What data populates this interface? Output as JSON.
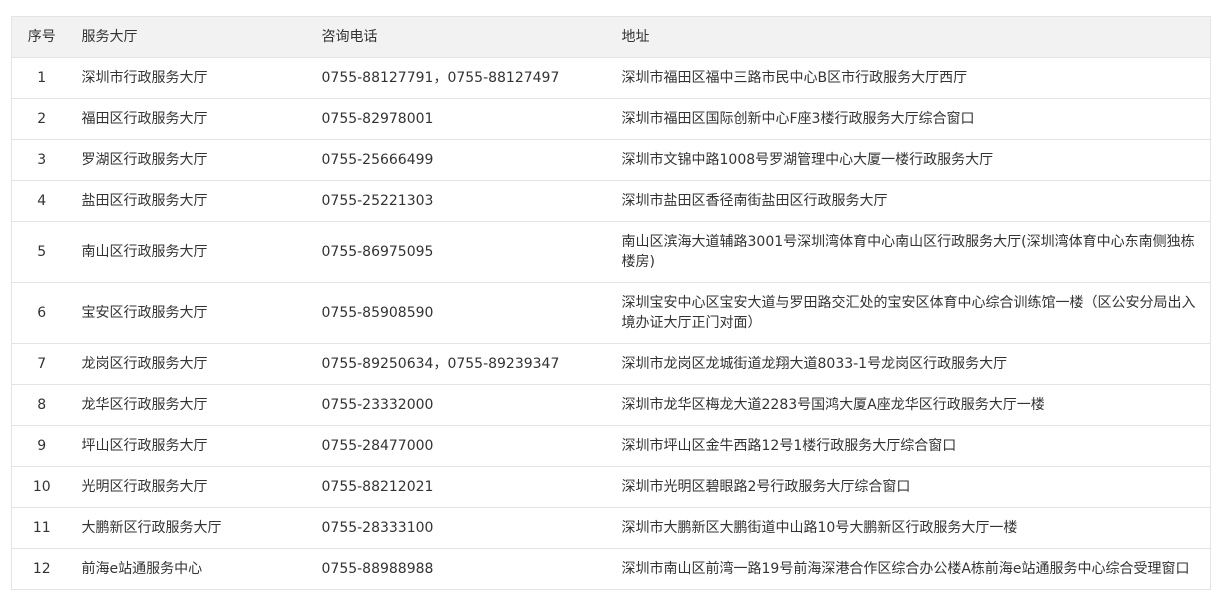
{
  "table": {
    "headers": [
      "序号",
      "服务大厅",
      "咨询电话",
      "地址"
    ],
    "rows": [
      {
        "no": "1",
        "hall": "深圳市行政服务大厅",
        "phone": "0755-88127791，0755-88127497",
        "address": "深圳市福田区福中三路市民中心B区市行政服务大厅西厅"
      },
      {
        "no": "2",
        "hall": "福田区行政服务大厅",
        "phone": "0755-82978001",
        "address": "深圳市福田区国际创新中心F座3楼行政服务大厅综合窗口"
      },
      {
        "no": "3",
        "hall": "罗湖区行政服务大厅",
        "phone": "0755-25666499",
        "address": "深圳市文锦中路1008号罗湖管理中心大厦一楼行政服务大厅"
      },
      {
        "no": "4",
        "hall": "盐田区行政服务大厅",
        "phone": "0755-25221303",
        "address": "深圳市盐田区香径南街盐田区行政服务大厅"
      },
      {
        "no": "5",
        "hall": "南山区行政服务大厅",
        "phone": "0755-86975095",
        "address": "南山区滨海大道辅路3001号深圳湾体育中心南山区行政服务大厅(深圳湾体育中心东南侧独栋楼房)"
      },
      {
        "no": "6",
        "hall": "宝安区行政服务大厅",
        "phone": "0755-85908590",
        "address": "深圳宝安中心区宝安大道与罗田路交汇处的宝安区体育中心综合训练馆一楼（区公安分局出入境办证大厅正门对面）"
      },
      {
        "no": "7",
        "hall": "龙岗区行政服务大厅",
        "phone": "0755-89250634，0755-89239347",
        "address": "深圳市龙岗区龙城街道龙翔大道8033-1号龙岗区行政服务大厅"
      },
      {
        "no": "8",
        "hall": "龙华区行政服务大厅",
        "phone": "0755-23332000",
        "address": "深圳市龙华区梅龙大道2283号国鸿大厦A座龙华区行政服务大厅一楼"
      },
      {
        "no": "9",
        "hall": "坪山区行政服务大厅",
        "phone": "0755-28477000",
        "address": "深圳市坪山区金牛西路12号1楼行政服务大厅综合窗口"
      },
      {
        "no": "10",
        "hall": "光明区行政服务大厅",
        "phone": "0755-88212021",
        "address": "深圳市光明区碧眼路2号行政服务大厅综合窗口"
      },
      {
        "no": "11",
        "hall": "大鹏新区行政服务大厅",
        "phone": "0755-28333100",
        "address": "深圳市大鹏新区大鹏街道中山路10号大鹏新区行政服务大厅一楼"
      },
      {
        "no": "12",
        "hall": "前海e站通服务中心",
        "phone": "0755-88988988",
        "address": "深圳市南山区前湾一路19号前海深港合作区综合办公楼A栋前海e站通服务中心综合受理窗口"
      }
    ]
  }
}
